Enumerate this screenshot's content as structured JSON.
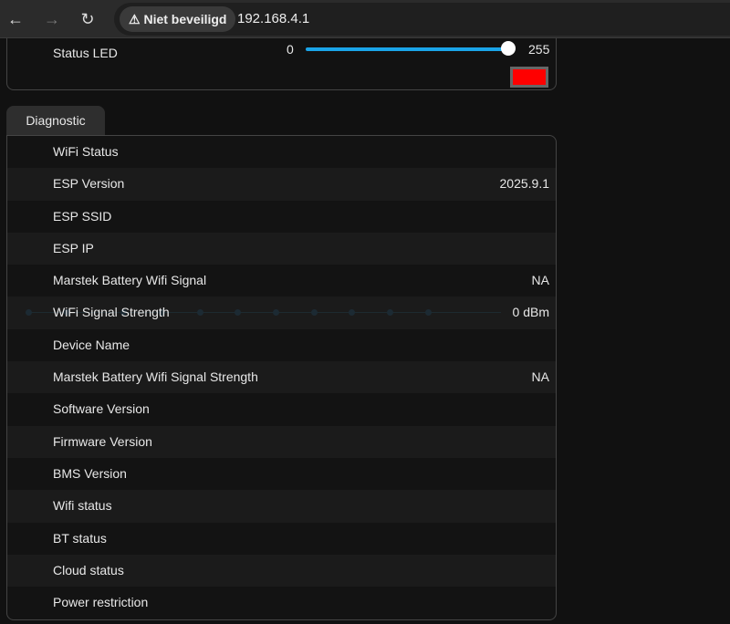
{
  "browser": {
    "security_label": "Niet beveiligd",
    "url": "192.168.4.1"
  },
  "status_led": {
    "label": "Status LED",
    "min": "0",
    "max": "255",
    "value_fraction": 1.0,
    "color": "#ff0000"
  },
  "diagnostic": {
    "tab": "Diagnostic",
    "rows": [
      {
        "label": "WiFi Status",
        "value": ""
      },
      {
        "label": "ESP Version",
        "value": "2025.9.1"
      },
      {
        "label": "ESP SSID",
        "value": ""
      },
      {
        "label": "ESP IP",
        "value": ""
      },
      {
        "label": "Marstek Battery Wifi Signal",
        "value": "NA"
      },
      {
        "label": "WiFi Signal Strength",
        "value": "0 dBm"
      },
      {
        "label": "Device Name",
        "value": ""
      },
      {
        "label": "Marstek Battery Wifi Signal Strength",
        "value": "NA"
      },
      {
        "label": "Software Version",
        "value": ""
      },
      {
        "label": "Firmware Version",
        "value": ""
      },
      {
        "label": "BMS Version",
        "value": ""
      },
      {
        "label": "Wifi status",
        "value": ""
      },
      {
        "label": "BT status",
        "value": ""
      },
      {
        "label": "Cloud status",
        "value": ""
      },
      {
        "label": "Power restriction",
        "value": ""
      }
    ]
  }
}
